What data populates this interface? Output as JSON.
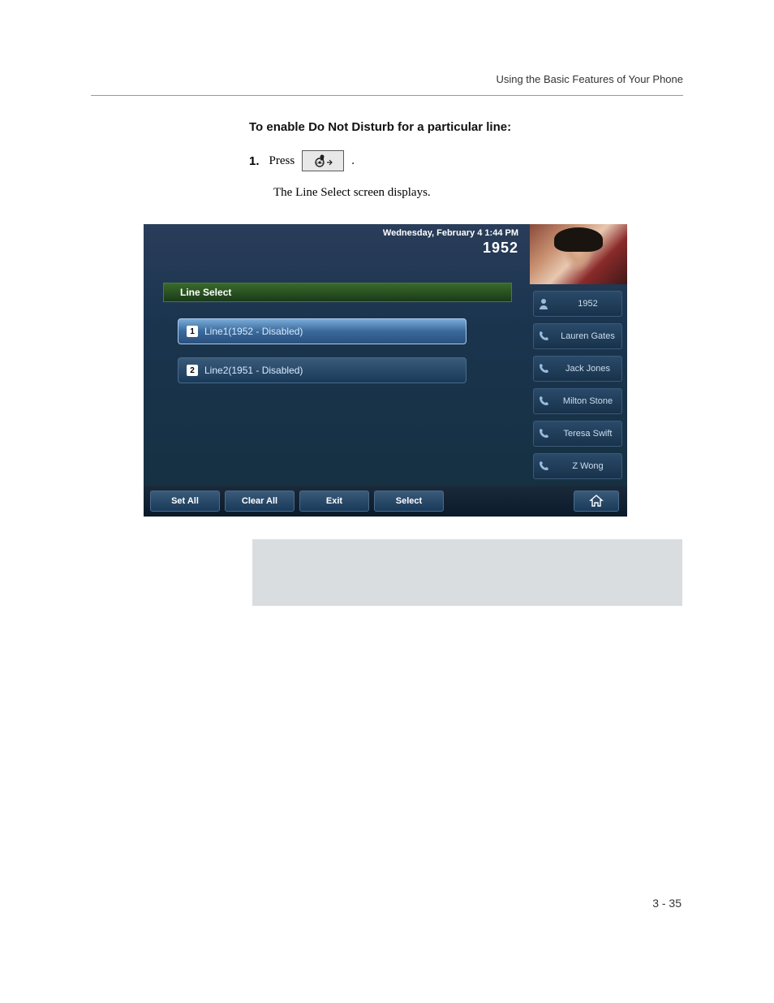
{
  "header": {
    "running_head": "Using the Basic Features of Your Phone"
  },
  "body": {
    "heading": "To enable Do Not Disturb for a particular line:",
    "step_number": "1.",
    "step_press": "Press",
    "step_period": ".",
    "step_result": "The Line Select screen displays."
  },
  "screen": {
    "date": "Wednesday, February 4  1:44 PM",
    "extension": "1952",
    "title": "Line Select",
    "lines": [
      {
        "badge": "1",
        "label": "Line1(1952 - Disabled)"
      },
      {
        "badge": "2",
        "label": "Line2(1951 - Disabled)"
      }
    ],
    "softkeys": {
      "set_all": "Set All",
      "clear_all": "Clear All",
      "exit": "Exit",
      "select": "Select"
    },
    "contacts": [
      {
        "label": "1952",
        "icon": "person"
      },
      {
        "label": "Lauren Gates",
        "icon": "handset"
      },
      {
        "label": "Jack Jones",
        "icon": "handset"
      },
      {
        "label": "Milton Stone",
        "icon": "handset"
      },
      {
        "label": "Teresa Swift",
        "icon": "handset"
      },
      {
        "label": "Z Wong",
        "icon": "handset"
      }
    ]
  },
  "footer": {
    "page": "3 - 35"
  }
}
